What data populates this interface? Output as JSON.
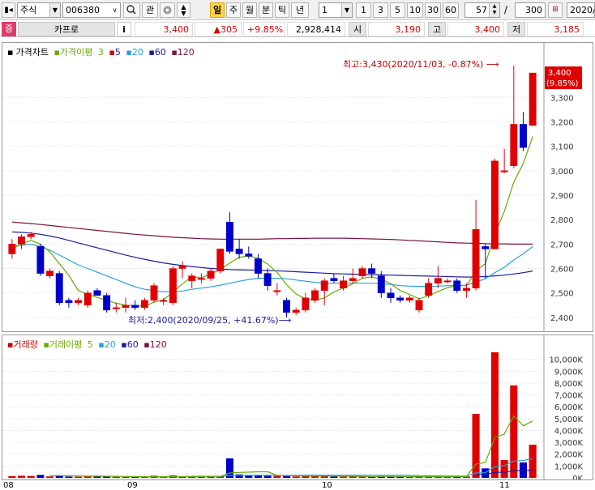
{
  "toolbar": {
    "market_type": "주식",
    "stock_code": "006380",
    "btn_gwan": "관",
    "btn_il": "일",
    "btn_ju": "주",
    "btn_wol": "월",
    "btn_bun": "분",
    "btn_tik": "틱",
    "btn_nyeon": "년",
    "interval_value": "1",
    "interval_options": [
      "1",
      "3",
      "5",
      "10",
      "30",
      "60"
    ],
    "count_value": "57",
    "slash": "/",
    "total_value": "300",
    "date_value": "2020/"
  },
  "quote": {
    "badge": "증",
    "stock_name": "카프로",
    "info_icon": "i",
    "price": "3,400",
    "change": "▲305",
    "change_pct": "+9.85%",
    "volume": "2,928,414",
    "open_label": "시",
    "open_value": "3,190",
    "high_label": "고",
    "high_value": "3,400",
    "low_label": "저",
    "low_value": "3,185"
  },
  "price_panel": {
    "legend": {
      "title": "가격차트",
      "ma_title": "가격이평",
      "ma_values": [
        "3",
        "5",
        "20",
        "60",
        "120"
      ]
    },
    "high_annotation": "최고:3,430(2020/11/03, -0.87%)",
    "low_annotation": "최저:2,400(2020/09/25, +41.67%)",
    "current_price_tag": "3,400",
    "current_pct_tag": "(9.85%)"
  },
  "volume_panel": {
    "legend": {
      "title": "거래량",
      "ma_title": "거래이평",
      "ma_values": [
        "5",
        "20",
        "60",
        "120"
      ]
    }
  },
  "colors": {
    "up": "#e00000",
    "down": "#0000cc",
    "ma3": "#e00000",
    "ma5": "#66aa00",
    "ma20": "#2aa0d8",
    "ma60": "#1a1aa0",
    "ma120": "#7a1040"
  },
  "chart_data": {
    "type": "candlestick",
    "x_axis_labels": [
      "08",
      "09",
      "10",
      "11"
    ],
    "price_axis_ticks": [
      2400,
      2500,
      2600,
      2700,
      2800,
      2900,
      3000,
      3100,
      3200,
      3300
    ],
    "price_ylim": [
      2350,
      3450
    ],
    "volume_axis_ticks": [
      "0K",
      "1,000K",
      "2,000K",
      "3,000K",
      "4,000K",
      "5,000K",
      "6,000K",
      "7,000K",
      "8,000K",
      "9,000K",
      "10,000K"
    ],
    "volume_ylim": [
      0,
      10800
    ],
    "candles": [
      {
        "o": 2660,
        "h": 2720,
        "l": 2640,
        "c": 2700
      },
      {
        "o": 2700,
        "h": 2740,
        "l": 2680,
        "c": 2730
      },
      {
        "o": 2730,
        "h": 2750,
        "l": 2720,
        "c": 2740
      },
      {
        "o": 2690,
        "h": 2700,
        "l": 2570,
        "c": 2580
      },
      {
        "o": 2570,
        "h": 2600,
        "l": 2560,
        "c": 2590
      },
      {
        "o": 2580,
        "h": 2590,
        "l": 2450,
        "c": 2460
      },
      {
        "o": 2470,
        "h": 2480,
        "l": 2440,
        "c": 2460
      },
      {
        "o": 2460,
        "h": 2480,
        "l": 2450,
        "c": 2470
      },
      {
        "o": 2450,
        "h": 2510,
        "l": 2440,
        "c": 2500
      },
      {
        "o": 2510,
        "h": 2520,
        "l": 2490,
        "c": 2490
      },
      {
        "o": 2490,
        "h": 2500,
        "l": 2420,
        "c": 2430
      },
      {
        "o": 2440,
        "h": 2460,
        "l": 2420,
        "c": 2440
      },
      {
        "o": 2440,
        "h": 2480,
        "l": 2420,
        "c": 2450
      },
      {
        "o": 2450,
        "h": 2470,
        "l": 2430,
        "c": 2440
      },
      {
        "o": 2440,
        "h": 2480,
        "l": 2430,
        "c": 2470
      },
      {
        "o": 2470,
        "h": 2540,
        "l": 2460,
        "c": 2530
      },
      {
        "o": 2470,
        "h": 2480,
        "l": 2450,
        "c": 2470
      },
      {
        "o": 2460,
        "h": 2610,
        "l": 2450,
        "c": 2600
      },
      {
        "o": 2600,
        "h": 2630,
        "l": 2560,
        "c": 2610
      },
      {
        "o": 2550,
        "h": 2580,
        "l": 2520,
        "c": 2570
      },
      {
        "o": 2560,
        "h": 2580,
        "l": 2540,
        "c": 2560
      },
      {
        "o": 2560,
        "h": 2600,
        "l": 2550,
        "c": 2590
      },
      {
        "o": 2590,
        "h": 2680,
        "l": 2580,
        "c": 2680
      },
      {
        "o": 2790,
        "h": 2830,
        "l": 2660,
        "c": 2670
      },
      {
        "o": 2680,
        "h": 2720,
        "l": 2640,
        "c": 2660
      },
      {
        "o": 2660,
        "h": 2690,
        "l": 2640,
        "c": 2650
      },
      {
        "o": 2640,
        "h": 2660,
        "l": 2560,
        "c": 2580
      },
      {
        "o": 2580,
        "h": 2600,
        "l": 2510,
        "c": 2530
      },
      {
        "o": 2510,
        "h": 2540,
        "l": 2490,
        "c": 2510
      },
      {
        "o": 2470,
        "h": 2480,
        "l": 2400,
        "c": 2420
      },
      {
        "o": 2420,
        "h": 2440,
        "l": 2410,
        "c": 2430
      },
      {
        "o": 2430,
        "h": 2500,
        "l": 2420,
        "c": 2480
      },
      {
        "o": 2470,
        "h": 2520,
        "l": 2460,
        "c": 2510
      },
      {
        "o": 2510,
        "h": 2560,
        "l": 2450,
        "c": 2550
      },
      {
        "o": 2560,
        "h": 2580,
        "l": 2540,
        "c": 2550
      },
      {
        "o": 2520,
        "h": 2570,
        "l": 2510,
        "c": 2550
      },
      {
        "o": 2550,
        "h": 2600,
        "l": 2540,
        "c": 2560
      },
      {
        "o": 2570,
        "h": 2610,
        "l": 2560,
        "c": 2600
      },
      {
        "o": 2600,
        "h": 2620,
        "l": 2560,
        "c": 2580
      },
      {
        "o": 2570,
        "h": 2590,
        "l": 2480,
        "c": 2500
      },
      {
        "o": 2500,
        "h": 2520,
        "l": 2460,
        "c": 2480
      },
      {
        "o": 2480,
        "h": 2490,
        "l": 2460,
        "c": 2470
      },
      {
        "o": 2470,
        "h": 2490,
        "l": 2460,
        "c": 2480
      },
      {
        "o": 2430,
        "h": 2480,
        "l": 2420,
        "c": 2470
      },
      {
        "o": 2490,
        "h": 2560,
        "l": 2480,
        "c": 2540
      },
      {
        "o": 2540,
        "h": 2610,
        "l": 2520,
        "c": 2560
      },
      {
        "o": 2550,
        "h": 2560,
        "l": 2540,
        "c": 2550
      },
      {
        "o": 2550,
        "h": 2560,
        "l": 2500,
        "c": 2510
      },
      {
        "o": 2510,
        "h": 2540,
        "l": 2480,
        "c": 2520
      },
      {
        "o": 2520,
        "h": 2880,
        "l": 2510,
        "c": 2760
      },
      {
        "o": 2690,
        "h": 2700,
        "l": 2560,
        "c": 2680
      },
      {
        "o": 2680,
        "h": 3050,
        "l": 2680,
        "c": 3040
      },
      {
        "o": 3000,
        "h": 3090,
        "l": 2990,
        "c": 3000
      },
      {
        "o": 3020,
        "h": 3430,
        "l": 3010,
        "c": 3190
      },
      {
        "o": 3190,
        "h": 3240,
        "l": 3080,
        "c": 3095
      },
      {
        "o": 3185,
        "h": 3400,
        "l": 3185,
        "c": 3400
      }
    ],
    "ma3": [
      2690,
      2710,
      2725,
      2685,
      2640,
      2545,
      2505,
      2465,
      2478,
      2486,
      2473,
      2450,
      2440,
      2443,
      2450,
      2480,
      2485,
      2533,
      2560,
      2595,
      2580,
      2573,
      2610,
      2640,
      2670,
      2660,
      2630,
      2590,
      2540,
      2490,
      2453,
      2443,
      2470,
      2510,
      2535,
      2550,
      2555,
      2570,
      2580,
      2560,
      2520,
      2483,
      2477,
      2473,
      2497,
      2523,
      2550,
      2540,
      2527,
      2600,
      2653,
      2827,
      2907,
      3077,
      3095,
      3230
    ],
    "ma5": [
      2680,
      2700,
      2715,
      2700,
      2668,
      2620,
      2572,
      2510,
      2494,
      2482,
      2470,
      2458,
      2450,
      2447,
      2446,
      2462,
      2472,
      2503,
      2538,
      2566,
      2562,
      2578,
      2596,
      2622,
      2646,
      2652,
      2642,
      2618,
      2584,
      2534,
      2496,
      2476,
      2470,
      2480,
      2504,
      2520,
      2538,
      2560,
      2566,
      2556,
      2538,
      2510,
      2494,
      2476,
      2488,
      2506,
      2522,
      2530,
      2530,
      2590,
      2620,
      2740,
      2833,
      2953,
      3030,
      3140
    ],
    "ma20": [
      2690,
      2695,
      2700,
      2690,
      2675,
      2655,
      2635,
      2615,
      2600,
      2585,
      2570,
      2555,
      2540,
      2525,
      2515,
      2510,
      2505,
      2505,
      2508,
      2515,
      2520,
      2525,
      2532,
      2540,
      2548,
      2555,
      2560,
      2560,
      2560,
      2558,
      2553,
      2548,
      2543,
      2540,
      2540,
      2540,
      2540,
      2540,
      2540,
      2538,
      2535,
      2530,
      2528,
      2527,
      2527,
      2528,
      2530,
      2530,
      2532,
      2545,
      2558,
      2583,
      2605,
      2635,
      2660,
      2690
    ],
    "ma60": [
      2750,
      2748,
      2745,
      2740,
      2733,
      2725,
      2715,
      2705,
      2695,
      2685,
      2675,
      2665,
      2655,
      2646,
      2638,
      2630,
      2623,
      2617,
      2612,
      2608,
      2604,
      2600,
      2598,
      2596,
      2595,
      2594,
      2593,
      2592,
      2591,
      2589,
      2587,
      2585,
      2583,
      2581,
      2579,
      2578,
      2577,
      2576,
      2575,
      2574,
      2573,
      2572,
      2571,
      2570,
      2569,
      2568,
      2567,
      2566,
      2565,
      2566,
      2567,
      2570,
      2573,
      2578,
      2583,
      2590
    ],
    "ma120": [
      2790,
      2787,
      2784,
      2780,
      2776,
      2772,
      2768,
      2764,
      2760,
      2756,
      2752,
      2748,
      2744,
      2740,
      2737,
      2734,
      2731,
      2728,
      2726,
      2724,
      2722,
      2721,
      2720,
      2720,
      2720,
      2720,
      2720,
      2721,
      2722,
      2722,
      2723,
      2723,
      2724,
      2724,
      2724,
      2724,
      2723,
      2722,
      2721,
      2720,
      2719,
      2717,
      2715,
      2713,
      2711,
      2709,
      2707,
      2705,
      2704,
      2703,
      2702,
      2701,
      2701,
      2700,
      2700,
      2700
    ],
    "volumes": [
      150,
      180,
      160,
      250,
      120,
      220,
      110,
      100,
      160,
      120,
      170,
      90,
      80,
      70,
      90,
      180,
      60,
      200,
      130,
      110,
      90,
      100,
      150,
      1650,
      300,
      200,
      250,
      180,
      160,
      150,
      120,
      150,
      160,
      200,
      120,
      100,
      110,
      130,
      100,
      150,
      120,
      90,
      80,
      100,
      130,
      120,
      80,
      90,
      110,
      5400,
      800,
      10600,
      1500,
      7800,
      1300,
      2800
    ],
    "vol_ma5": [
      null,
      null,
      null,
      null,
      172,
      186,
      172,
      160,
      142,
      142,
      136,
      128,
      116,
      102,
      96,
      98,
      94,
      104,
      112,
      124,
      118,
      126,
      116,
      420,
      458,
      480,
      510,
      516,
      220,
      188,
      176,
      162,
      148,
      156,
      150,
      146,
      138,
      132,
      112,
      118,
      122,
      118,
      108,
      108,
      104,
      104,
      100,
      104,
      106,
      1164,
      1296,
      3400,
      3700,
      5220,
      4400,
      4800
    ],
    "vol_ma20": [
      null,
      null,
      null,
      null,
      null,
      null,
      null,
      null,
      null,
      null,
      null,
      null,
      null,
      null,
      null,
      null,
      null,
      null,
      null,
      140,
      137,
      133,
      132,
      205,
      213,
      212,
      218,
      222,
      220,
      222,
      220,
      222,
      224,
      225,
      225,
      222,
      225,
      222,
      220,
      218,
      216,
      212,
      208,
      180,
      170,
      166,
      158,
      154,
      150,
      410,
      440,
      960,
      1030,
      1410,
      1470,
      1600
    ],
    "vol_ma60": [
      null,
      null,
      null,
      null,
      null,
      null,
      null,
      null,
      null,
      null,
      null,
      null,
      null,
      null,
      null,
      null,
      null,
      null,
      null,
      null,
      null,
      null,
      null,
      null,
      null,
      null,
      null,
      null,
      null,
      null,
      null,
      null,
      null,
      null,
      null,
      null,
      null,
      null,
      null,
      null,
      null,
      null,
      null,
      null,
      null,
      null,
      null,
      null,
      null,
      280,
      290,
      460,
      480,
      600,
      620,
      660
    ]
  }
}
